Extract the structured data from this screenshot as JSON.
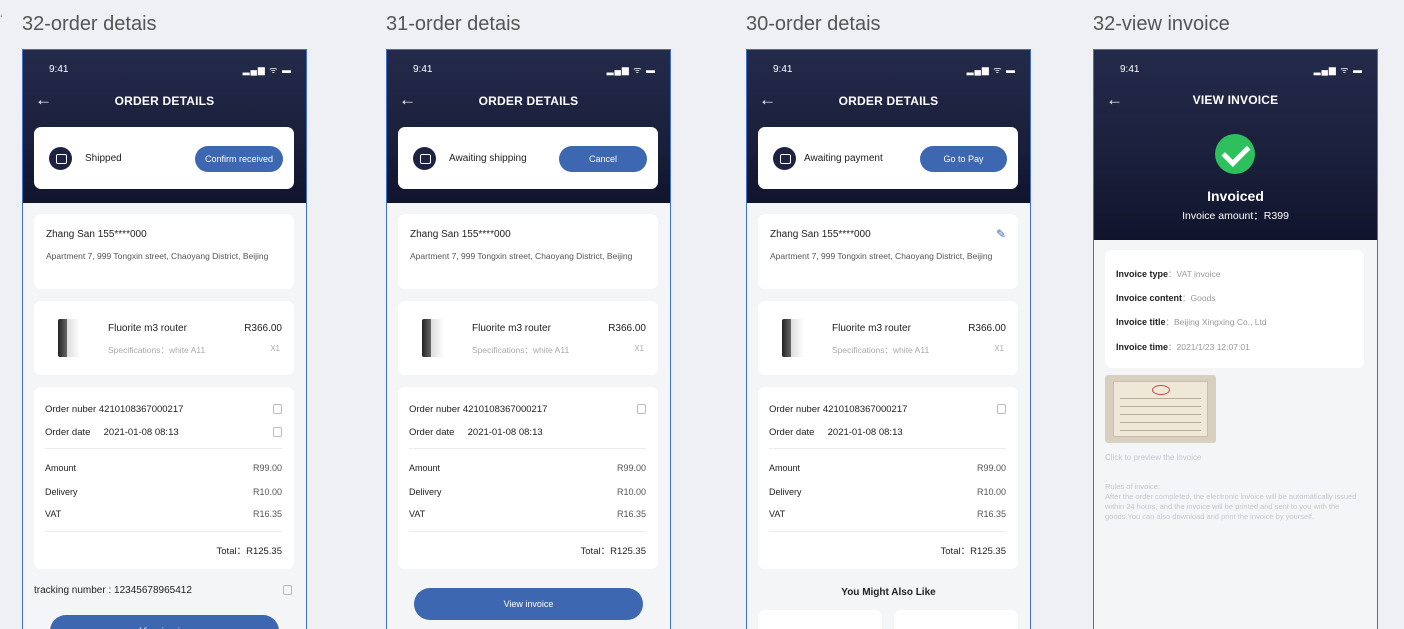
{
  "boards": [
    {
      "label": "32-order detais"
    },
    {
      "label": "31-order detais"
    },
    {
      "label": "30-order detais"
    },
    {
      "label": "32-view invoice"
    }
  ],
  "status_bar": {
    "time": "9:41",
    "icons": "▂▄▆ ᯤ ▬"
  },
  "back_arrow": "←",
  "order_title": "ORDER DETAILS",
  "screen1": {
    "status": "Shipped",
    "action": "Confirm received",
    "tracking": "tracking number : 12345678965412",
    "bottom_button": "View invoice"
  },
  "screen2": {
    "status": "Awaiting shipping",
    "action": "Cancel",
    "bottom_button": "View invoice"
  },
  "screen3": {
    "status": "Awaiting payment",
    "action": "Go to Pay",
    "also_like": "You Might Also Like",
    "edit_icon": "✎"
  },
  "address": {
    "name": "Zhang San   155****000",
    "line": "Apartment 7, 999 Tongxin street, Chaoyang District, Beijing"
  },
  "product": {
    "name": "Fluorite m3 router",
    "price": "R366.00",
    "spec": "Specifications：white A11",
    "qty": "X1"
  },
  "order": {
    "number_label": "Order nuber",
    "number": "4210108367000217",
    "date_label": "Order date",
    "date": "2021-01-08 08:13",
    "amount_label": "Amount",
    "amount": "R99.00",
    "delivery_label": "Delivery",
    "delivery": "R10.00",
    "vat_label": "VAT",
    "vat": "R16.35",
    "total": "Total：R125.35"
  },
  "invoice": {
    "title": "VIEW INVOICE",
    "status": "Invoiced",
    "amount": "Invoice amount：R399",
    "type_label": "Invoice type",
    "type": "：VAT invoice",
    "content_label": "Invoice content",
    "content": "：Goods",
    "title_label": "Invoice title",
    "title_value": "：Beijing Xingxing Co., Ltd",
    "time_label": "Invoice time",
    "time": "：2021/1/23 12:07:01",
    "preview": "Click to preview the invoice",
    "rules_title": "Rules of invoice:",
    "rules": "After the order completed, the electronic invoice will be automatically issued within 24 hours, and the invoice will be printed and sent to you with the goods.You can also download and print the invoice by yourself."
  }
}
